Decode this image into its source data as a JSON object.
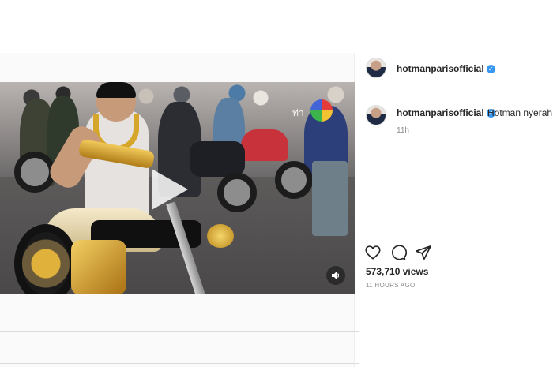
{
  "post": {
    "username": "hotmanparisofficial",
    "verified": true,
    "caption": {
      "username": "hotmanparisofficial",
      "text": "Hotman nyerah",
      "time": "11h"
    },
    "views": "573,710 views",
    "posted_ago": "11 HOURS AGO"
  },
  "video": {
    "overlay_text": "ท่า",
    "controls": {
      "play_icon": "play-icon",
      "mute_icon": "speaker-icon"
    }
  },
  "actions": {
    "like_icon": "heart-icon",
    "comment_icon": "comment-icon",
    "share_icon": "paper-plane-icon"
  },
  "colors": {
    "verified_badge": "#3897f0",
    "secondary_text": "#8e8e8e",
    "primary_text": "#262626"
  }
}
